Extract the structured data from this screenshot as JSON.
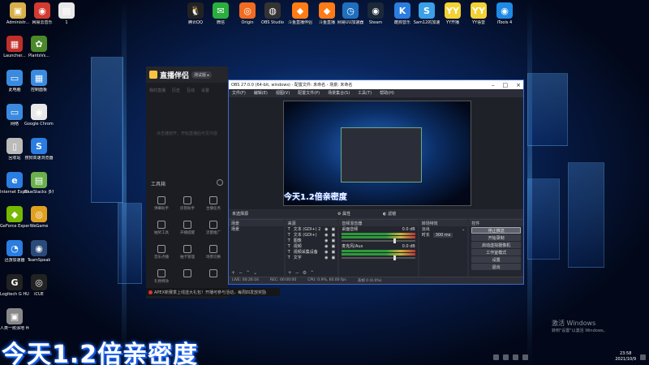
{
  "desktop_top_icons": [
    {
      "label": "Administr...",
      "color": "#d8b04a",
      "glyph": "▣"
    },
    {
      "label": "网易云音乐",
      "color": "#d33a31",
      "glyph": "◉"
    },
    {
      "label": "1",
      "color": "#e8e8e8",
      "glyph": "▤"
    },
    {
      "label": "腾讯QQ",
      "color": "#222222",
      "glyph": "🐧"
    },
    {
      "label": "微信",
      "color": "#2aae3d",
      "glyph": "✉"
    },
    {
      "label": "Origin",
      "color": "#f26b21",
      "glyph": "◎"
    },
    {
      "label": "OBS Studio",
      "color": "#333333",
      "glyph": "◍"
    },
    {
      "label": "斗鱼直播伴侣",
      "color": "#ff7b16",
      "glyph": "◆"
    },
    {
      "label": "斗鱼直播",
      "color": "#ff7b16",
      "glyph": "◆"
    },
    {
      "label": "网易UU加速器",
      "color": "#1f6fbf",
      "glyph": "◷"
    },
    {
      "label": "Steam",
      "color": "#1b2838",
      "glyph": "◉"
    },
    {
      "label": "酷狗音乐",
      "color": "#2a7de1",
      "glyph": "K"
    },
    {
      "label": "Sam12的加速",
      "color": "#3aa0e8",
      "glyph": "S"
    },
    {
      "label": "YY开播",
      "color": "#f3d233",
      "glyph": "YY"
    },
    {
      "label": "YY语音",
      "color": "#f3d233",
      "glyph": "YY"
    },
    {
      "label": "iTools 4",
      "color": "#1f8ae5",
      "glyph": "◉"
    }
  ],
  "desktop_left_icons": [
    {
      "label": "Launcher...",
      "color": "#c0302a",
      "glyph": "▦"
    },
    {
      "label": "PlantsVs...",
      "color": "#4a8a2a",
      "glyph": "✿"
    },
    {
      "label": "此电脑",
      "color": "#3a8be0",
      "glyph": "▭"
    },
    {
      "label": "控制面板",
      "color": "#3a8be0",
      "glyph": "▦"
    },
    {
      "label": "网络",
      "color": "#3a8be0",
      "glyph": "▭"
    },
    {
      "label": "Google Chrome",
      "color": "#e8e8e8",
      "glyph": "◉"
    },
    {
      "label": "回收站",
      "color": "#bbbbbb",
      "glyph": "▯"
    },
    {
      "label": "搜狗高速浏览器",
      "color": "#2a7de1",
      "glyph": "S"
    },
    {
      "label": "Internet Explorer",
      "color": "#2a7de1",
      "glyph": "e"
    },
    {
      "label": "BlueStacks 多开管理器",
      "color": "#6ab04c",
      "glyph": "▤"
    },
    {
      "label": "GeForce Experience",
      "color": "#76b900",
      "glyph": "◆"
    },
    {
      "label": "WeGame",
      "color": "#e0a020",
      "glyph": "◎"
    },
    {
      "label": "迅游加速器",
      "color": "#2a7de1",
      "glyph": "◔"
    },
    {
      "label": "TeamSpeak",
      "color": "#2a4a7a",
      "glyph": "◉"
    },
    {
      "label": "Logitech G HUB",
      "color": "#222222",
      "glyph": "G"
    },
    {
      "label": "iCUE",
      "color": "#222222",
      "glyph": "◎"
    },
    {
      "label": "人类一败涂地 Human Fa...",
      "color": "#888888",
      "glyph": "▣"
    }
  ],
  "companion": {
    "title": "直播伴侣",
    "version": "测试版 ▸",
    "tabs": [
      "我的直播",
      "历史",
      "互动",
      "设置"
    ],
    "empty_text": "点击播放开，开始直播后可见内容",
    "tools_title": "工具箱",
    "tools": [
      "弹幕助手",
      "房管助手",
      "主播任务",
      "抽奖工具",
      "开播提醒",
      "流量推广",
      "音乐点播",
      "抽卡管理",
      "场景切换",
      "礼物特效",
      "",
      ""
    ],
    "alert_text": "APEX新赛季上线送大礼包！开播可参与活动，每周四发放奖励"
  },
  "obs": {
    "title": "OBS 27.0.0 (64-bit, windows) - 配置文件: 未命名 - 场景: 未命名",
    "menu": [
      "文件(F)",
      "编辑(E)",
      "视图(V)",
      "配置文件(P)",
      "场景集合(S)",
      "工具(T)",
      "帮助(H)"
    ],
    "preview_caption": "今天1.2倍亲密度",
    "mode_left": "未选择源",
    "mode_props": "属性",
    "mode_filters": "滤镜",
    "docks": {
      "scenes": {
        "header": "场景",
        "items": [
          "场景"
        ]
      },
      "sources": {
        "header": "来源",
        "items": [
          "文本 (GDI+) 2",
          "文本 (GDI+)",
          "图像",
          "视频",
          "视频采集设备",
          "文字"
        ]
      },
      "mixer": {
        "header": "音频混音器",
        "channels": [
          {
            "name": "桌面音频",
            "db": "0.0 dB"
          },
          {
            "name": "麦克风/Aux",
            "db": "0.0 dB"
          }
        ]
      },
      "transitions": {
        "header": "转场特效",
        "type": "淡出",
        "duration_label": "时长",
        "duration": "300 ms"
      },
      "controls": {
        "header": "控件",
        "buttons": [
          "停止推流",
          "开始录制",
          "启动虚拟摄像机",
          "工作室模式",
          "设置",
          "退出"
        ]
      }
    },
    "status": [
      "LIVE: 00:26:16",
      "REC: 00:00:00",
      "CPU: 0.9%, 60.00 fps",
      "丢帧 0 (0.0%)"
    ]
  },
  "caption": "今天1.2倍亲密度",
  "watermark": {
    "line1": "激活 Windows",
    "line2": "转到\"设置\"以激活 Windows。"
  },
  "tray": {
    "time": "23:58",
    "date": "2021/10/9"
  }
}
